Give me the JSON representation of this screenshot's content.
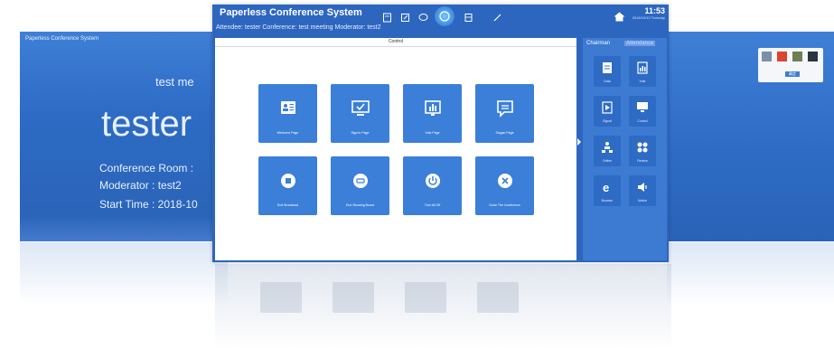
{
  "left_screen": {
    "app_title": "Paperless Conference System",
    "meeting": "test me",
    "name": "tester",
    "room": "Conference Room :",
    "moderator": "Moderator : test2",
    "start_time": "Start Time : 2018-10"
  },
  "window": {
    "title": "Paperless Conference System",
    "subtitle": "Attendee: tester  Conference: test meeting  Moderator: test2",
    "clock": "11:53",
    "clock_sub": "2018/10/10 Tuesday",
    "toolbar_icons": [
      "file-icon",
      "edit-icon",
      "chat-icon",
      "home-circle-icon",
      "vote-icon",
      "pen-icon"
    ]
  },
  "panel": {
    "title": "Control",
    "tiles": [
      {
        "label": "Welcome Page",
        "icon": "contact-card-icon"
      },
      {
        "label": "Sign in Page",
        "icon": "monitor-check-icon"
      },
      {
        "label": "Vote Page",
        "icon": "bar-chart-icon"
      },
      {
        "label": "Slogan Page",
        "icon": "message-icon"
      },
      {
        "label": "End Broadcast",
        "icon": "stop-icon"
      },
      {
        "label": "End Showing Board",
        "icon": "minus-circle-icon"
      },
      {
        "label": "Turn All Off",
        "icon": "power-icon"
      },
      {
        "label": "Close The Conference",
        "icon": "close-circle-icon"
      }
    ]
  },
  "side": {
    "tab_chairman": "Chairman",
    "tab_attendance": "Attendance",
    "buttons": [
      {
        "label": "Data",
        "icon": "document-icon"
      },
      {
        "label": "Vote",
        "icon": "chart-icon"
      },
      {
        "label": "Signal",
        "icon": "signal-icon"
      },
      {
        "label": "Control",
        "icon": "monitor-icon"
      },
      {
        "label": "Online",
        "icon": "users-icon"
      },
      {
        "label": "Review",
        "icon": "review-icon"
      },
      {
        "label": "Browser",
        "icon": "browser-icon"
      },
      {
        "label": "Notice",
        "icon": "speaker-icon"
      }
    ]
  },
  "right_screen": {
    "swatch_colors": [
      "#7a8fa8",
      "#d9462e",
      "#6f7d55",
      "#2b3440"
    ],
    "ok_label": "确定"
  },
  "colors": {
    "brand": "#2d66bf",
    "tile": "#3b7fd8"
  }
}
